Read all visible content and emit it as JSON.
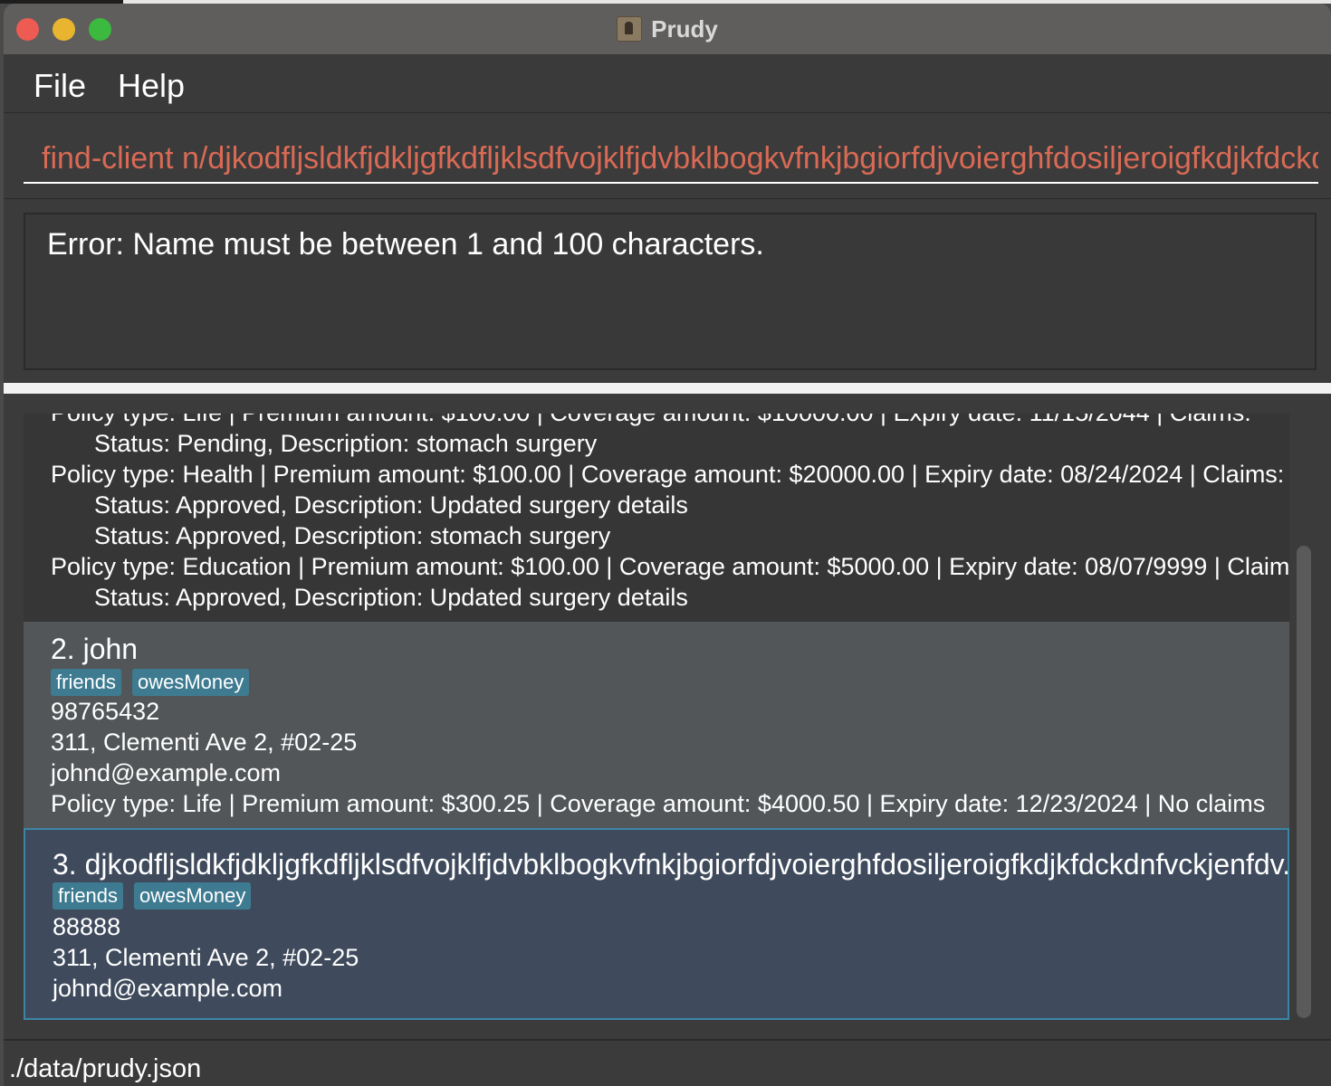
{
  "window": {
    "title": "Prudy"
  },
  "menu": {
    "items": [
      "File",
      "Help"
    ]
  },
  "command_box": {
    "value": "find-client n/djkodfljsldkfjdkljgfkdfljklsdfvojklfjdvbklbogkvfnkjbgiorfdjvoierghfdosiljeroigfkdjkfdckdnfvckjenfdv"
  },
  "result": {
    "message": "Error: Name must be between 1 and 100 characters."
  },
  "clients": [
    {
      "partial": true,
      "lines": [
        {
          "text": "Policy type: Life | Premium amount: $100.00 | Coverage amount: $10000.00 | Expiry date: 11/15/2044 | Claims:",
          "indent": false
        },
        {
          "text": "Status: Pending, Description: stomach surgery",
          "indent": true
        },
        {
          "text": "Policy type: Health | Premium amount: $100.00 | Coverage amount: $20000.00 | Expiry date: 08/24/2024 | Claims:",
          "indent": false
        },
        {
          "text": "Status: Approved, Description: Updated surgery details",
          "indent": true
        },
        {
          "text": "Status: Approved, Description: stomach surgery",
          "indent": true
        },
        {
          "text": "Policy type: Education | Premium amount: $100.00 | Coverage amount: $5000.00 | Expiry date: 08/07/9999 | Claims:",
          "indent": false
        },
        {
          "text": "Status: Approved, Description: Updated surgery details",
          "indent": true
        }
      ]
    },
    {
      "name": "2. john",
      "tags": [
        "friends",
        "owesMoney"
      ],
      "phone": "98765432",
      "address": "311, Clementi Ave 2, #02-25",
      "email": "johnd@example.com",
      "policy": "Policy type: Life | Premium amount: $300.25 | Coverage amount: $4000.50 | Expiry date: 12/23/2024 | No claims"
    },
    {
      "name": "3. djkodfljsldkfjdkljgfkdfljklsdfvojklfjdvbklbogkvfnkjbgiorfdjvoierghfdosiljeroigfkdjkfdckdnfvckjenfdv...",
      "tags": [
        "friends",
        "owesMoney"
      ],
      "phone": "88888",
      "address": "311, Clementi Ave 2, #02-25",
      "email": "johnd@example.com",
      "selected": true
    }
  ],
  "status_bar": {
    "path": "./data/prudy.json"
  },
  "colors": {
    "command_text": "#d96a55",
    "tag_bg": "#3e7b91",
    "selected_border": "#3a86a5"
  }
}
